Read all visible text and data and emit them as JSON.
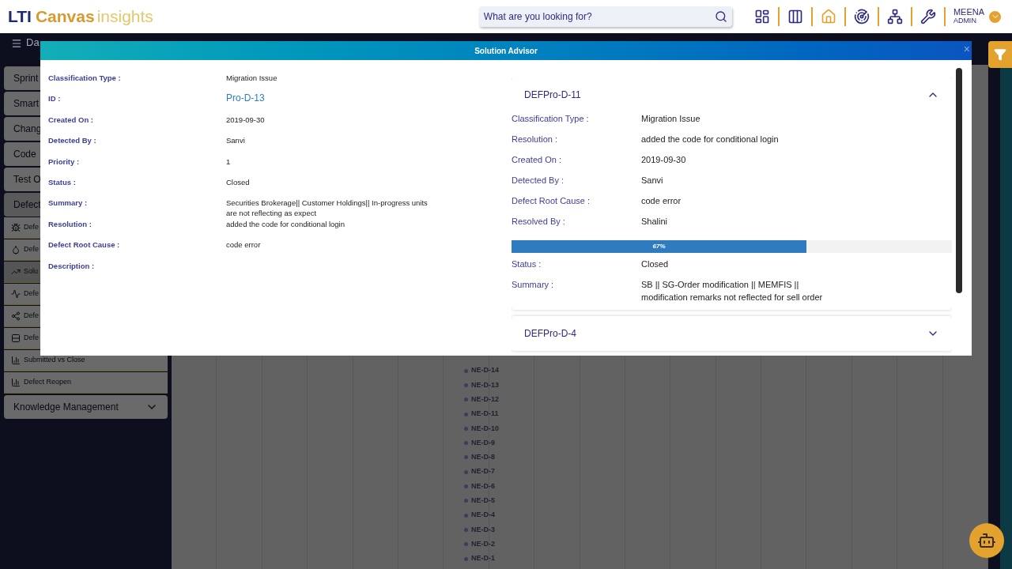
{
  "header": {
    "logo": {
      "brand": "LTI",
      "product": "Canvas",
      "suffix": "insights"
    },
    "search": {
      "placeholder": "What are you looking for?"
    },
    "user": {
      "name": "MEENA",
      "role": "ADMIN"
    }
  },
  "nav": {
    "title": "Da"
  },
  "sidebar": {
    "items": [
      {
        "label": "Sprint",
        "expanded": false
      },
      {
        "label": "Smart",
        "expanded": false
      },
      {
        "label": "Chang",
        "expanded": false
      },
      {
        "label": "Code",
        "expanded": false
      },
      {
        "label": "Test O",
        "expanded": false
      },
      {
        "label": "Defect",
        "expanded": true,
        "children": [
          {
            "label": "Defe",
            "selected": false
          },
          {
            "label": "Defe",
            "selected": false
          },
          {
            "label": "Solu",
            "selected": true
          },
          {
            "label": "Defe",
            "selected": false
          },
          {
            "label": "Defe",
            "selected": false
          },
          {
            "label": "Defe",
            "selected": false
          },
          {
            "label": "Submitted vs Close",
            "selected": false
          },
          {
            "label": "Defect Reopen",
            "selected": false
          }
        ]
      },
      {
        "label": "Knowledge Management",
        "expanded": false
      }
    ]
  },
  "chart": {
    "items": [
      "NE-D-14",
      "NE-D-13",
      "NE-D-12",
      "NE-D-11",
      "NE-D-10",
      "NE-D-9",
      "NE-D-8",
      "NE-D-7",
      "NE-D-6",
      "NE-D-5",
      "NE-D-4",
      "NE-D-3",
      "NE-D-2",
      "NE-D-1"
    ]
  },
  "modal": {
    "title": "Solution Advisor",
    "close": "×",
    "details": [
      {
        "label": "Classification Type :",
        "value": "Migration Issue",
        "kind": "text"
      },
      {
        "label": "ID :",
        "value": "Pro-D-13",
        "kind": "link"
      },
      {
        "label": "Created On :",
        "value": "2019-09-30",
        "kind": "text"
      },
      {
        "label": "Detected By :",
        "value": "Sanvi",
        "kind": "text"
      },
      {
        "label": "Priority :",
        "value": "1",
        "kind": "text"
      },
      {
        "label": "Status :",
        "value": "Closed",
        "kind": "text"
      },
      {
        "label": "Summary :",
        "value": "Securities Brokerage|| Customer Holdings|| In-progress units are not reflecting as expect",
        "kind": "text"
      },
      {
        "label": "Resolution :",
        "value": "added the code for conditional login",
        "kind": "text"
      },
      {
        "label": "Defect Root Cause :",
        "value": "code error",
        "kind": "text"
      },
      {
        "label": "Description :"
      }
    ],
    "solutions": [
      {
        "title": "DEFPro-D-11",
        "expanded": true,
        "fields": [
          {
            "label": "Classification Type :",
            "value": "Migration Issue",
            "kind": "field"
          },
          {
            "label": "Resolution :",
            "value": "added the code for conditional login",
            "kind": "field"
          },
          {
            "label": "Created On :",
            "value": "2019-09-30",
            "kind": "field"
          },
          {
            "label": "Detected By :",
            "value": "Sanvi",
            "kind": "field"
          },
          {
            "label": "Defect Root Cause :",
            "value": "code error",
            "kind": "field"
          },
          {
            "label": "Resolved By :",
            "value": "Shalini",
            "kind": "field"
          },
          {
            "kind": "progress",
            "level": 0.67,
            "label": "67%"
          },
          {
            "label": "Status :",
            "value": "Closed",
            "kind": "field"
          },
          {
            "label": "Summary :",
            "value": "SB || SG-Order modification || MEMFIS || modification remarks not reflected for sell order",
            "kind": "field"
          }
        ]
      },
      {
        "title": "DEFPro-D-4",
        "expanded": false
      }
    ]
  }
}
